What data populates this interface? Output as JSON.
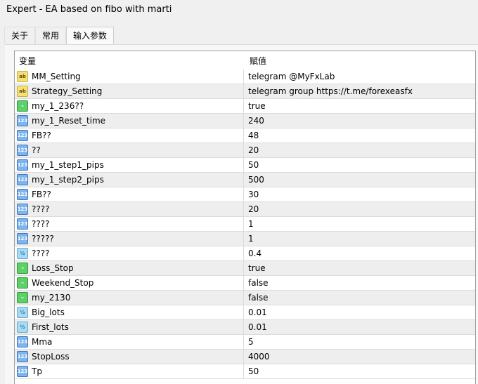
{
  "window": {
    "title": "Expert - EA based on fibo with marti"
  },
  "tabs": [
    {
      "label": "关于"
    },
    {
      "label": "常用"
    },
    {
      "label": "输入参数"
    }
  ],
  "table": {
    "headers": [
      "变量",
      "赋值"
    ],
    "rows": [
      {
        "icon": "ab",
        "name": "MM_Setting",
        "value": "telegram @MyFxLab"
      },
      {
        "icon": "ab",
        "name": "Strategy_Setting",
        "value": "telegram group https://t.me/forexeasfx"
      },
      {
        "icon": "bool",
        "name": "my_1_236??",
        "value": "true"
      },
      {
        "icon": "int",
        "name": "my_1_Reset_time",
        "value": "240"
      },
      {
        "icon": "int",
        "name": "FB??",
        "value": "48"
      },
      {
        "icon": "int",
        "name": "??",
        "value": "20"
      },
      {
        "icon": "int",
        "name": "my_1_step1_pips",
        "value": "50"
      },
      {
        "icon": "int",
        "name": "my_1_step2_pips",
        "value": "500"
      },
      {
        "icon": "int",
        "name": "FB??",
        "value": "30"
      },
      {
        "icon": "int",
        "name": "????",
        "value": "20"
      },
      {
        "icon": "int",
        "name": "????",
        "value": "1"
      },
      {
        "icon": "int",
        "name": "?????",
        "value": "1"
      },
      {
        "icon": "dbl",
        "name": "????",
        "value": "0.4"
      },
      {
        "icon": "bool",
        "name": "Loss_Stop",
        "value": "true"
      },
      {
        "icon": "bool",
        "name": "Weekend_Stop",
        "value": "false"
      },
      {
        "icon": "bool",
        "name": "my_2130",
        "value": "false"
      },
      {
        "icon": "dbl",
        "name": "Big_lots",
        "value": "0.01"
      },
      {
        "icon": "dbl",
        "name": "First_lots",
        "value": "0.01"
      },
      {
        "icon": "int",
        "name": "Mma",
        "value": "5"
      },
      {
        "icon": "int",
        "name": "StopLoss",
        "value": "4000"
      },
      {
        "icon": "int",
        "name": "Tp",
        "value": "50"
      }
    ]
  },
  "icon_glyphs": {
    "ab": "ab",
    "bool": "⌁",
    "int": "123",
    "dbl": "½"
  }
}
